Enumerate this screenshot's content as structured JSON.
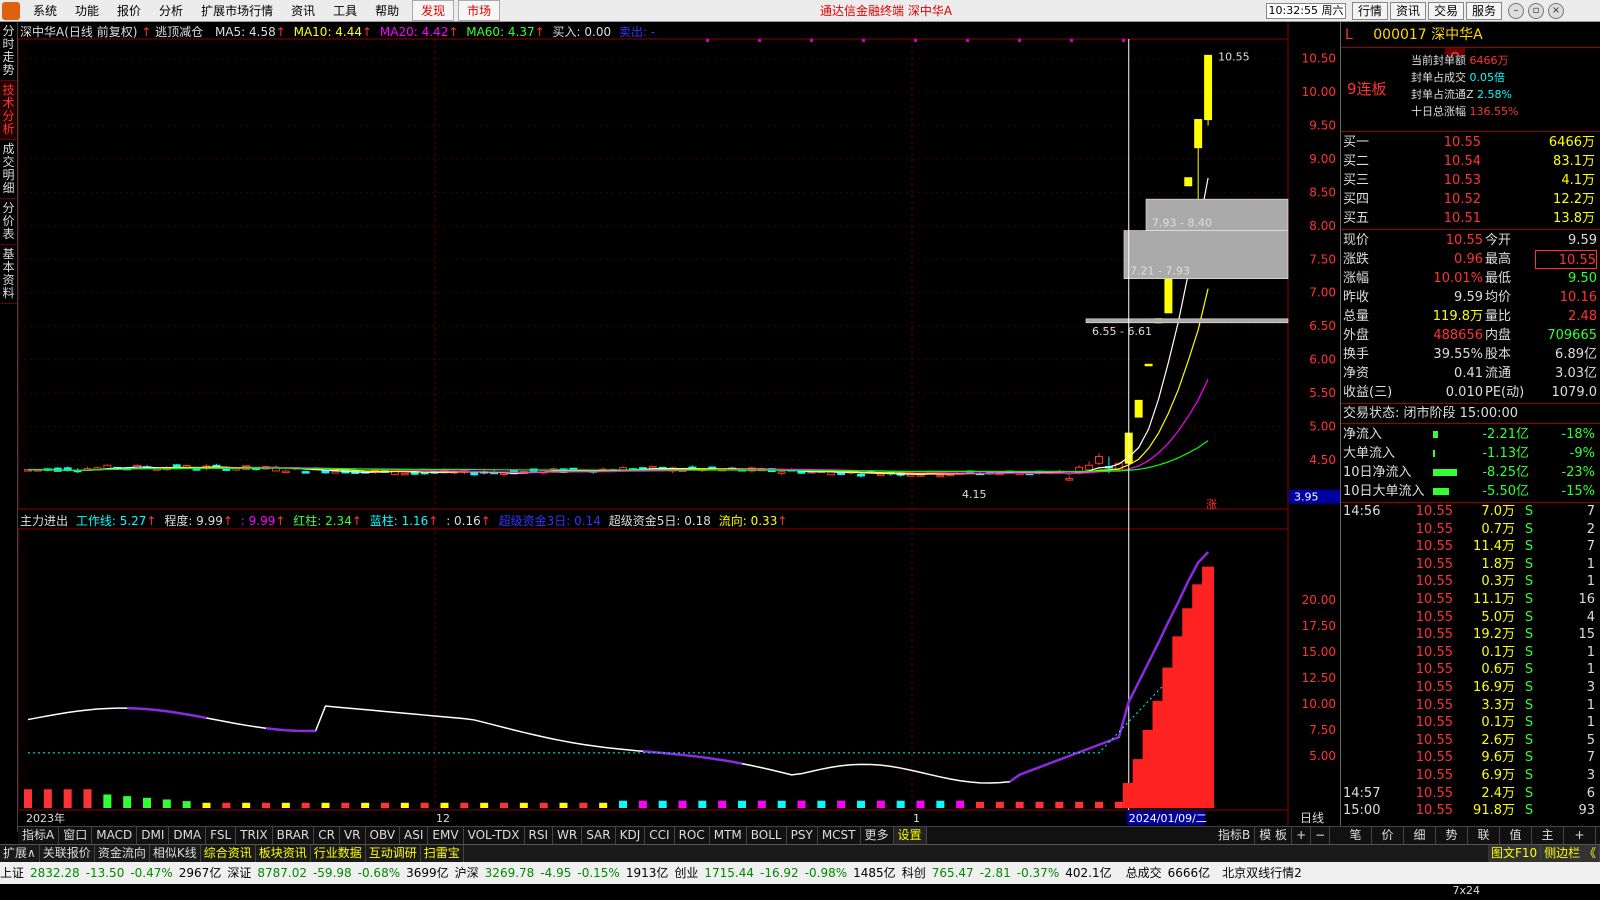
{
  "menubar": {
    "items": [
      "系统",
      "功能",
      "报价",
      "分析",
      "扩展市场行情",
      "资讯",
      "工具",
      "帮助"
    ],
    "tab_discover": "发现",
    "tab_market": "市场",
    "center_title": "通达信金融终端  深中华A",
    "clock": "10:32:55 周六",
    "right_buttons": [
      "行情",
      "资讯",
      "交易",
      "服务"
    ]
  },
  "side_tabs": [
    "分时走势",
    "技术分析",
    "成交明细",
    "分价表",
    "基本资料"
  ],
  "main_chart": {
    "indicator_line": {
      "stock": "深中华A(日线 前复权)",
      "formula": "逃顶减仓",
      "ma5": "MA5: 4.58",
      "ma10": "MA10: 4.44",
      "ma20": "MA20: 4.42",
      "ma60": "MA60: 4.37",
      "buy": "买入: 0.00",
      "sell": "卖出: -"
    },
    "price_labels": [
      "10.50",
      "10.00",
      "9.50",
      "9.00",
      "8.50",
      "8.00",
      "7.50",
      "7.00",
      "6.50",
      "6.00",
      "5.50",
      "5.00",
      "4.50"
    ],
    "current_price_tag": "3.95",
    "high_label": "10.55",
    "low_label": "4.15",
    "zone_labels": [
      "7.93 - 8.40",
      "7.21 - 7.93",
      "6.55 - 6.61"
    ],
    "limit_mark": "涨"
  },
  "sub_chart": {
    "indicator_line": {
      "name": "主力进出",
      "work": "工作线: 5.27",
      "degree": "程度: 9.99",
      "deg2": ": 9.99",
      "red": "红柱: 2.34",
      "blue": "蓝柱: 1.16",
      "v016": ": 0.16",
      "super3": "超级资金3日: 0.14",
      "super5": "超级资金5日: 0.18",
      "flow": "流向: 0.33"
    },
    "value_labels": [
      "20.00",
      "17.50",
      "15.00",
      "12.50",
      "10.00",
      "7.50",
      "5.00"
    ],
    "date_labels": [
      "2023年",
      "12",
      "1"
    ],
    "cursor_date": "2024/01/09/二",
    "period": "日线"
  },
  "right_panel": {
    "code": "000017",
    "name": "深中华A",
    "flag": "L",
    "streak": "9连板",
    "banner": [
      {
        "label": "当前封单额",
        "value": "6466万"
      },
      {
        "label": "封单占成交",
        "value": "0.05倍"
      },
      {
        "label": "封单占流通Z",
        "value": "2.58%"
      },
      {
        "label": "十日总涨幅",
        "value": "136.55%"
      }
    ],
    "orderbook": [
      {
        "label": "买一",
        "price": "10.55",
        "vol": "6466万"
      },
      {
        "label": "买二",
        "price": "10.54",
        "vol": "83.1万"
      },
      {
        "label": "买三",
        "price": "10.53",
        "vol": "4.1万"
      },
      {
        "label": "买四",
        "price": "10.52",
        "vol": "12.2万"
      },
      {
        "label": "买五",
        "price": "10.51",
        "vol": "13.8万"
      }
    ],
    "quote": [
      {
        "l1": "现价",
        "v1": "10.55",
        "l2": "今开",
        "v2": "9.59"
      },
      {
        "l1": "涨跌",
        "v1": "0.96",
        "l2": "最高",
        "v2": "10.55"
      },
      {
        "l1": "涨幅",
        "v1": "10.01%",
        "l2": "最低",
        "v2": "9.50"
      },
      {
        "l1": "昨收",
        "v1": "9.59",
        "l2": "均价",
        "v2": "10.16"
      },
      {
        "l1": "总量",
        "v1": "119.8万",
        "l2": "量比",
        "v2": "2.48"
      },
      {
        "l1": "外盘",
        "v1": "488656",
        "l2": "内盘",
        "v2": "709665"
      },
      {
        "l1": "换手",
        "v1": "39.55%",
        "l2": "股本",
        "v2": "6.89亿"
      },
      {
        "l1": "净资",
        "v1": "0.41",
        "l2": "流通",
        "v2": "3.03亿"
      },
      {
        "l1": "收益(三)",
        "v1": "0.010",
        "l2": "PE(动)",
        "v2": "1079.0"
      }
    ],
    "status": "交易状态: 闭市阶段 15:00:00",
    "flow": [
      {
        "label": "净流入",
        "v1": "-2.21亿",
        "v2": "-18%",
        "bar": 0.12
      },
      {
        "label": "大单流入",
        "v1": "-1.13亿",
        "v2": "-9%",
        "bar": 0.06
      },
      {
        "label": "10日净流入",
        "v1": "-8.25亿",
        "v2": "-23%",
        "bar": 0.6
      },
      {
        "label": "10日大单流入",
        "v1": "-5.50亿",
        "v2": "-15%",
        "bar": 0.4
      }
    ],
    "ticks": [
      {
        "t": "14:56",
        "p": "10.55",
        "v": "7.0万",
        "s": "S",
        "n": "7"
      },
      {
        "t": "",
        "p": "10.55",
        "v": "0.7万",
        "s": "S",
        "n": "2"
      },
      {
        "t": "",
        "p": "10.55",
        "v": "11.4万",
        "s": "S",
        "n": "7"
      },
      {
        "t": "",
        "p": "10.55",
        "v": "1.8万",
        "s": "S",
        "n": "1"
      },
      {
        "t": "",
        "p": "10.55",
        "v": "0.3万",
        "s": "S",
        "n": "1"
      },
      {
        "t": "",
        "p": "10.55",
        "v": "11.1万",
        "s": "S",
        "n": "16"
      },
      {
        "t": "",
        "p": "10.55",
        "v": "5.0万",
        "s": "S",
        "n": "4"
      },
      {
        "t": "",
        "p": "10.55",
        "v": "19.2万",
        "s": "S",
        "n": "15"
      },
      {
        "t": "",
        "p": "10.55",
        "v": "0.1万",
        "s": "S",
        "n": "1"
      },
      {
        "t": "",
        "p": "10.55",
        "v": "0.6万",
        "s": "S",
        "n": "1"
      },
      {
        "t": "",
        "p": "10.55",
        "v": "16.9万",
        "s": "S",
        "n": "3"
      },
      {
        "t": "",
        "p": "10.55",
        "v": "3.3万",
        "s": "S",
        "n": "1"
      },
      {
        "t": "",
        "p": "10.55",
        "v": "0.1万",
        "s": "S",
        "n": "1"
      },
      {
        "t": "",
        "p": "10.55",
        "v": "2.6万",
        "s": "S",
        "n": "5"
      },
      {
        "t": "",
        "p": "10.55",
        "v": "9.6万",
        "s": "S",
        "n": "7"
      },
      {
        "t": "",
        "p": "10.55",
        "v": "6.9万",
        "s": "S",
        "n": "3"
      },
      {
        "t": "14:57",
        "p": "10.55",
        "v": "2.4万",
        "s": "S",
        "n": "6"
      },
      {
        "t": "15:00",
        "p": "10.55",
        "v": "91.8万",
        "s": "S",
        "n": "93"
      }
    ],
    "tabs": [
      "笔",
      "价",
      "细",
      "势",
      "联",
      "值",
      "主",
      "+"
    ]
  },
  "bottom_tabs": [
    "指标A",
    "窗口",
    "MACD",
    "DMI",
    "DMA",
    "FSL",
    "TRIX",
    "BRAR",
    "CR",
    "VR",
    "OBV",
    "ASI",
    "EMV",
    "VOL-TDX",
    "RSI",
    "WR",
    "SAR",
    "KDJ",
    "CCI",
    "ROC",
    "MTM",
    "BOLL",
    "PSY",
    "MCST",
    "更多",
    "设置"
  ],
  "bottom_tabs_right": [
    "指标B",
    "模 板",
    "+",
    "−"
  ],
  "ext_bar": [
    "扩展∧",
    "关联报价",
    "资金流向",
    "相似K线",
    "综合资讯",
    "板块资讯",
    "行业数据",
    "互动调研",
    "扫雷宝"
  ],
  "ext_bar_right": [
    "图文F10",
    "侧边栏 《"
  ],
  "status_bar": [
    {
      "name": "上证",
      "price": "2832.28",
      "chg": "-13.50",
      "pct": "-0.47%",
      "amt": "2967亿"
    },
    {
      "name": "深证",
      "price": "8787.02",
      "chg": "-59.98",
      "pct": "-0.68%",
      "amt": "3699亿"
    },
    {
      "name": "沪深",
      "price": "3269.78",
      "chg": "-4.95",
      "pct": "-0.15%",
      "amt": "1913亿"
    },
    {
      "name": "创业",
      "price": "1715.44",
      "chg": "-16.92",
      "pct": "-0.98%",
      "amt": "1485亿"
    },
    {
      "name": "科创",
      "price": "765.47",
      "chg": "-2.81",
      "pct": "-0.37%",
      "amt": "402.1亿"
    }
  ],
  "status_total_label": "总成交",
  "status_total": "6666亿",
  "status_server": "北京双线行情2",
  "status_size": "7x24",
  "chart_data": {
    "type": "candlestick",
    "price_axis": {
      "min": 4.0,
      "max": 10.7,
      "ticks": [
        4.5,
        5.0,
        5.5,
        6.0,
        6.5,
        7.0,
        7.5,
        8.0,
        8.5,
        9.0,
        9.5,
        10.0,
        10.5
      ]
    },
    "candles_tail": [
      {
        "o": 4.22,
        "h": 4.26,
        "l": 4.18,
        "c": 4.22
      },
      {
        "o": 4.3,
        "h": 4.42,
        "l": 4.28,
        "c": 4.39
      },
      {
        "o": 4.35,
        "h": 4.48,
        "l": 4.3,
        "c": 4.42
      },
      {
        "o": 4.45,
        "h": 4.6,
        "l": 4.42,
        "c": 4.55
      },
      {
        "o": 4.4,
        "h": 4.55,
        "l": 4.3,
        "c": 4.38
      },
      {
        "o": 4.35,
        "h": 4.46,
        "l": 4.32,
        "c": 4.45
      },
      {
        "o": 4.45,
        "h": 4.9,
        "l": 4.45,
        "c": 4.9
      },
      {
        "o": 5.39,
        "h": 5.39,
        "l": 5.14,
        "c": 5.14
      },
      {
        "o": 5.93,
        "h": 5.93,
        "l": 5.93,
        "c": 5.93
      },
      {
        "o": 6.55,
        "h": 6.61,
        "l": 6.55,
        "c": 6.61
      },
      {
        "o": 6.7,
        "h": 7.21,
        "l": 6.7,
        "c": 7.21
      },
      {
        "o": 7.93,
        "h": 7.93,
        "l": 7.93,
        "c": 7.93
      },
      {
        "o": 8.6,
        "h": 8.72,
        "l": 8.6,
        "c": 8.72
      },
      {
        "o": 9.59,
        "h": 9.59,
        "l": 8.4,
        "c": 9.17
      },
      {
        "o": 9.59,
        "h": 10.55,
        "l": 9.5,
        "c": 10.55
      }
    ],
    "sub_series": {
      "work_line_axis": {
        "min": 0,
        "max": 24,
        "ticks": [
          5,
          7.5,
          10,
          12.5,
          15,
          17.5,
          20
        ]
      },
      "red_bars_tail": [
        2.4,
        4.7,
        7.5,
        10.3,
        13.5,
        16.5,
        19.2,
        21.5,
        23.2
      ]
    }
  }
}
